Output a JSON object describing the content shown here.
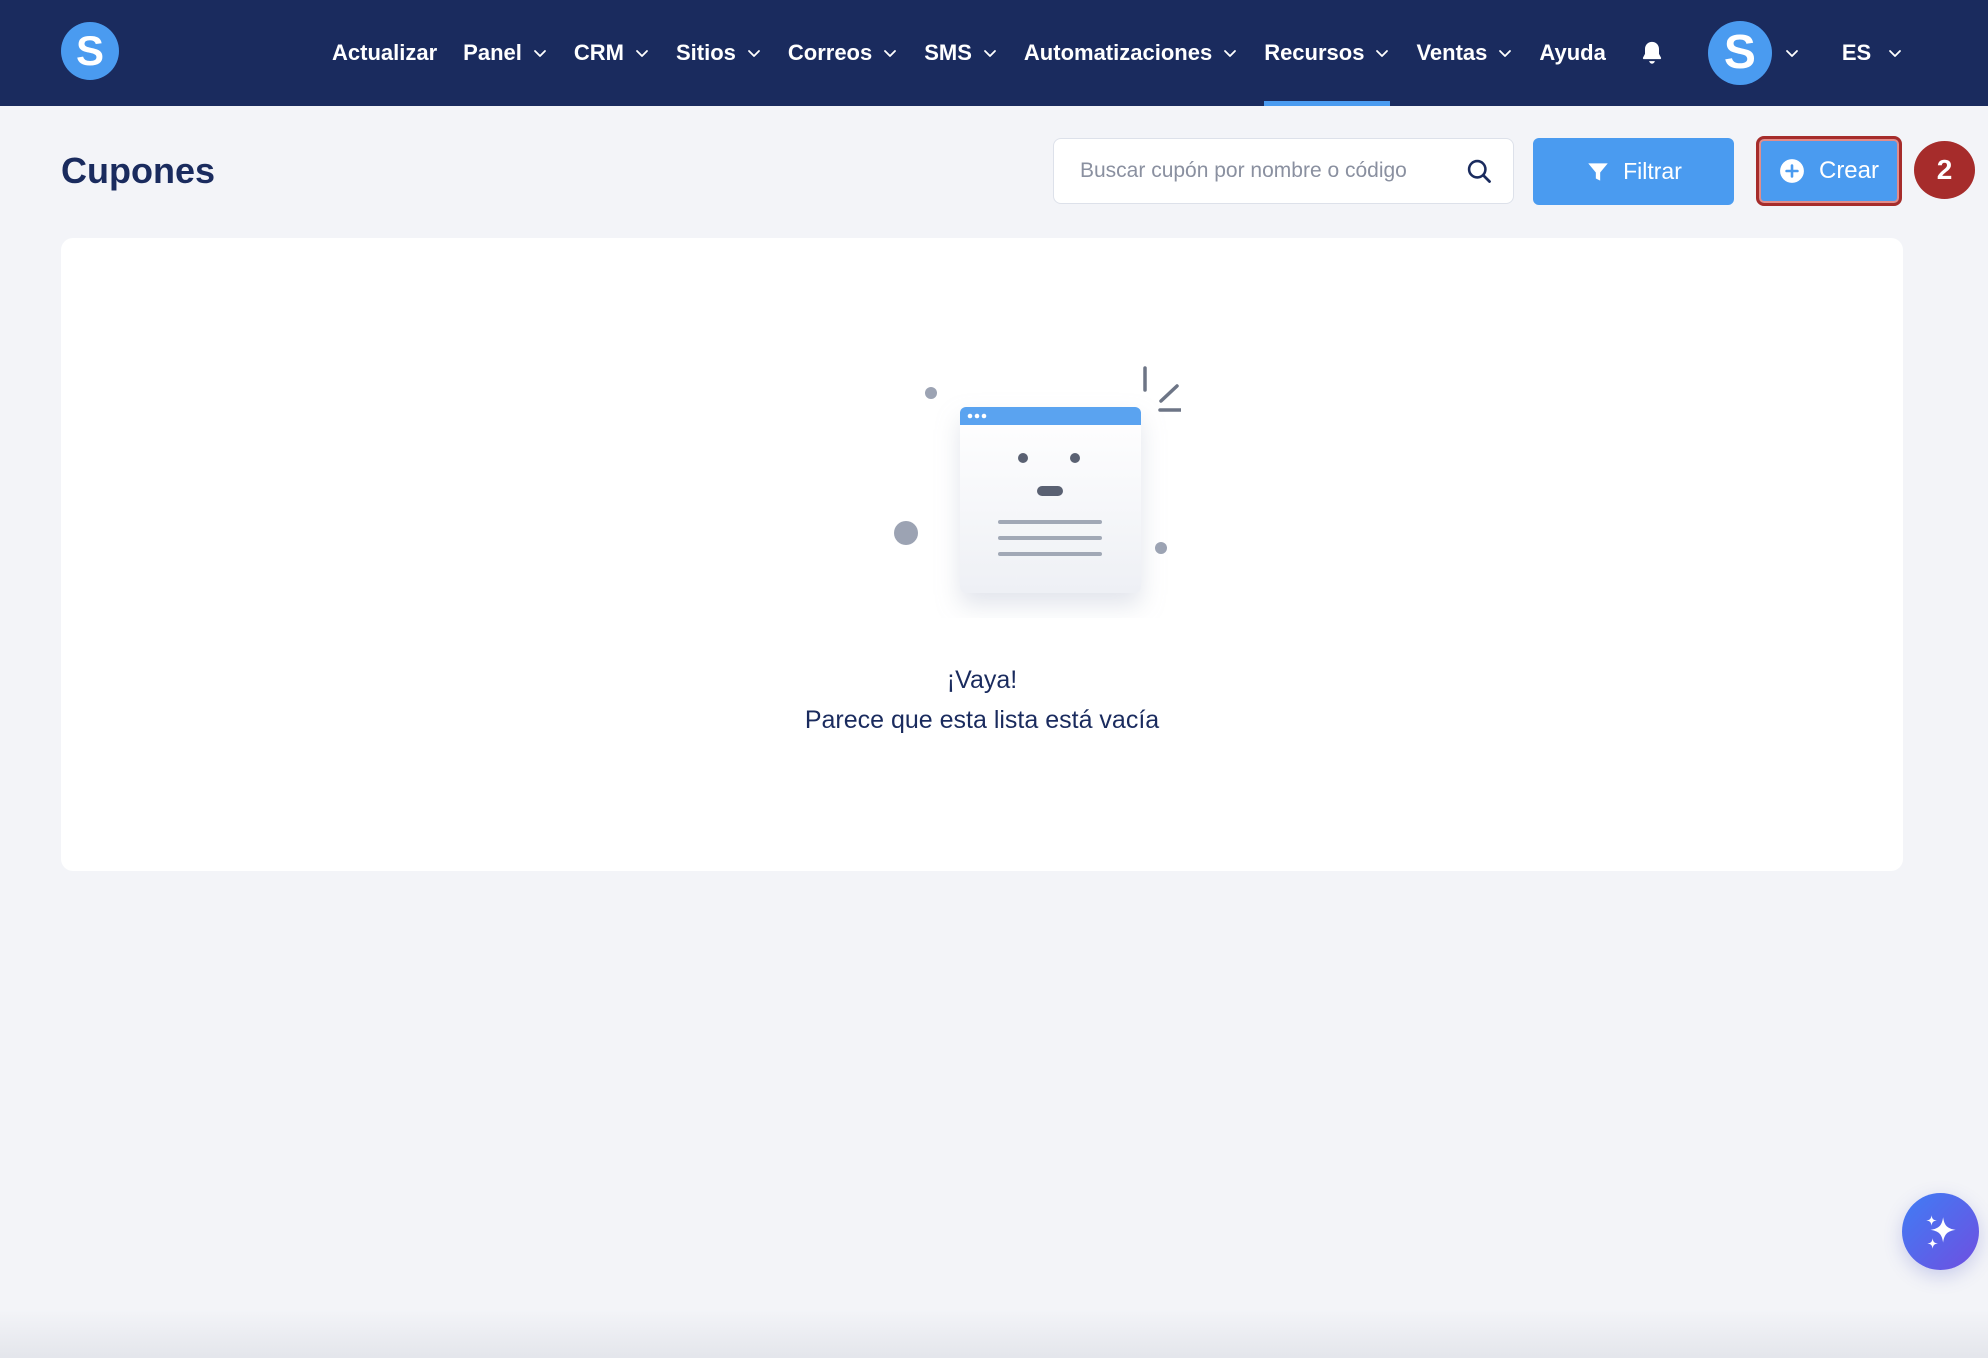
{
  "brand": {
    "logo_letter": "S"
  },
  "nav": {
    "items": [
      {
        "label": "Actualizar",
        "has_dropdown": false,
        "active": false
      },
      {
        "label": "Panel",
        "has_dropdown": true,
        "active": false
      },
      {
        "label": "CRM",
        "has_dropdown": true,
        "active": false
      },
      {
        "label": "Sitios",
        "has_dropdown": true,
        "active": false
      },
      {
        "label": "Correos",
        "has_dropdown": true,
        "active": false
      },
      {
        "label": "SMS",
        "has_dropdown": true,
        "active": false
      },
      {
        "label": "Automatizaciones",
        "has_dropdown": true,
        "active": false
      },
      {
        "label": "Recursos",
        "has_dropdown": true,
        "active": true
      },
      {
        "label": "Ventas",
        "has_dropdown": true,
        "active": false
      },
      {
        "label": "Ayuda",
        "has_dropdown": false,
        "active": false
      }
    ],
    "notification_icon": "bell-icon",
    "avatar_letter": "S",
    "language": "ES"
  },
  "page": {
    "title": "Cupones",
    "search": {
      "placeholder": "Buscar cupón por nombre o código",
      "value": ""
    },
    "filter_label": "Filtrar",
    "create_label": "Crear",
    "step_number": "2"
  },
  "empty_state": {
    "title": "¡Vaya!",
    "subtitle": "Parece que esta lista está vacía"
  },
  "colors": {
    "nav_bg": "#1a2b5e",
    "accent": "#4a9bf0",
    "highlight": "#a62c2b",
    "page_bg": "#f3f4f8"
  }
}
